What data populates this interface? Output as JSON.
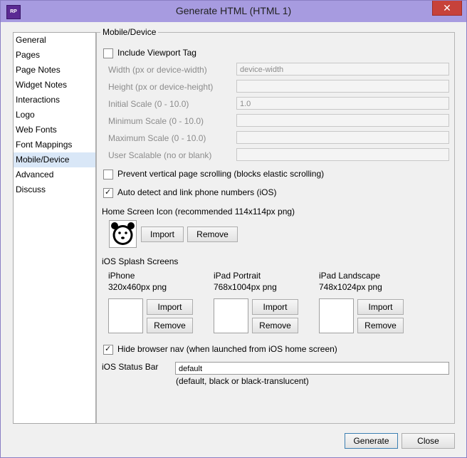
{
  "window": {
    "title": "Generate HTML (HTML 1)",
    "app_icon_text": "RP",
    "close_glyph": "✕"
  },
  "nav": {
    "items": [
      "General",
      "Pages",
      "Page Notes",
      "Widget Notes",
      "Interactions",
      "Logo",
      "Web Fonts",
      "Font Mappings",
      "Mobile/Device",
      "Advanced",
      "Discuss"
    ],
    "selected": "Mobile/Device"
  },
  "panel": {
    "legend": "Mobile/Device",
    "viewport": {
      "label": "Include Viewport Tag",
      "checked": false,
      "fields": [
        {
          "label": "Width (px or device-width)",
          "value": "device-width"
        },
        {
          "label": "Height (px or device-height)",
          "value": ""
        },
        {
          "label": "Initial Scale (0 - 10.0)",
          "value": "1.0"
        },
        {
          "label": "Minimum Scale (0 - 10.0)",
          "value": ""
        },
        {
          "label": "Maximum Scale (0 - 10.0)",
          "value": ""
        },
        {
          "label": "User Scalable (no or blank)",
          "value": ""
        }
      ]
    },
    "prevent_scroll": {
      "label": "Prevent vertical page scrolling (blocks elastic scrolling)",
      "checked": false
    },
    "auto_detect": {
      "label": "Auto detect and link phone numbers (iOS)",
      "checked": true
    },
    "home_icon": {
      "label": "Home Screen Icon (recommended 114x114px png)",
      "import_label": "Import",
      "remove_label": "Remove"
    },
    "splash": {
      "label": "iOS Splash Screens",
      "items": [
        {
          "name": "iPhone",
          "size": "320x460px png",
          "import_label": "Import",
          "remove_label": "Remove"
        },
        {
          "name": "iPad Portrait",
          "size": "768x1004px png",
          "import_label": "Import",
          "remove_label": "Remove"
        },
        {
          "name": "iPad Landscape",
          "size": "748x1024px png",
          "import_label": "Import",
          "remove_label": "Remove"
        }
      ]
    },
    "hide_nav": {
      "label": "Hide browser nav (when launched from iOS home screen)",
      "checked": true
    },
    "status_bar": {
      "label": "iOS Status Bar",
      "value": "default",
      "hint": "(default, black or black-translucent)"
    }
  },
  "footer": {
    "generate_label": "Generate",
    "close_label": "Close"
  },
  "colors": {
    "titlebar": "#a79be0",
    "close": "#c7423a",
    "selected_nav": "#d9e7f7"
  }
}
